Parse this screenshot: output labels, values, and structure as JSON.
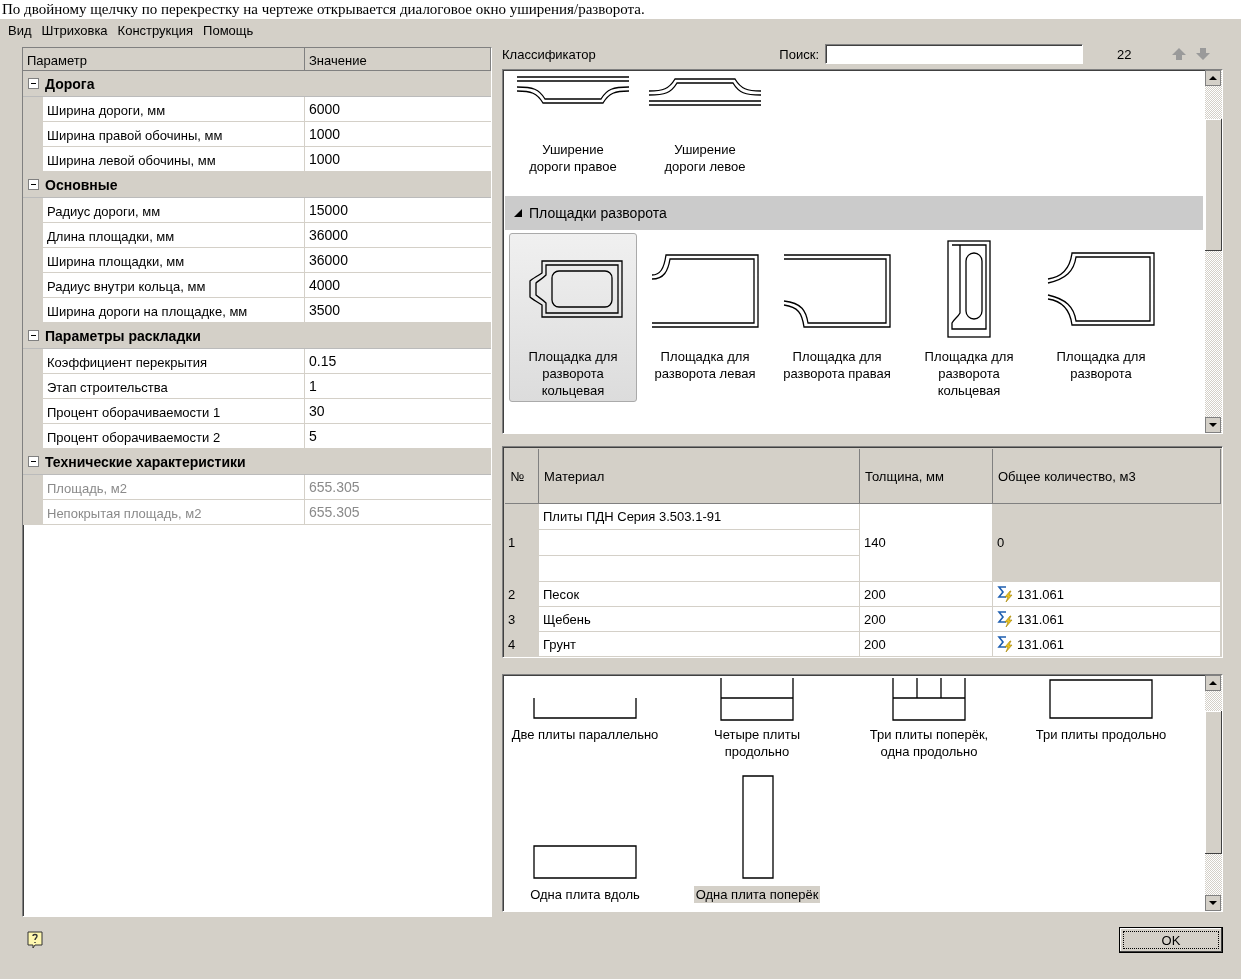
{
  "caption": "По двойному щелчку по перекрестку на чертеже открывается диалоговое окно уширения/разворота.",
  "menu": [
    "Вид",
    "Штриховка",
    "Конструкция",
    "Помощь"
  ],
  "properties": {
    "columns": [
      "Параметр",
      "Значение"
    ],
    "groups": [
      {
        "title": "Дорога",
        "expanded": true,
        "rows": [
          {
            "name": "Ширина дороги, мм",
            "value": "6000",
            "disabled": false
          },
          {
            "name": "Ширина правой обочины, мм",
            "value": "1000",
            "disabled": false
          },
          {
            "name": "Ширина левой обочины, мм",
            "value": "1000",
            "disabled": false
          }
        ]
      },
      {
        "title": "Основные",
        "expanded": true,
        "rows": [
          {
            "name": "Радиус дороги, мм",
            "value": "15000",
            "disabled": false
          },
          {
            "name": "Длина площадки, мм",
            "value": "36000",
            "disabled": false
          },
          {
            "name": "Ширина площадки, мм",
            "value": "36000",
            "disabled": false
          },
          {
            "name": "Радиус внутри кольца, мм",
            "value": "4000",
            "disabled": false
          },
          {
            "name": "Ширина дороги на площадке, мм",
            "value": "3500",
            "disabled": false
          }
        ]
      },
      {
        "title": "Параметры раскладки",
        "expanded": true,
        "rows": [
          {
            "name": "Коэффициент перекрытия",
            "value": "0.15",
            "disabled": false
          },
          {
            "name": "Этап строительства",
            "value": "1",
            "disabled": false
          },
          {
            "name": "Процент оборачиваемости 1",
            "value": "30",
            "disabled": false
          },
          {
            "name": "Процент оборачиваемости 2",
            "value": "5",
            "disabled": false
          }
        ]
      },
      {
        "title": "Технические характеристики",
        "expanded": true,
        "rows": [
          {
            "name": "Площадь, м2",
            "value": "655.305",
            "disabled": true
          },
          {
            "name": "Непокрытая площадь, м2",
            "value": "655.305",
            "disabled": true
          }
        ]
      }
    ]
  },
  "classifier": {
    "label": "Классификатор",
    "search_label": "Поиск:",
    "count": "22"
  },
  "gallery_top": {
    "sections": [
      {
        "items": [
          {
            "kind": "widening-right",
            "label": "Уширение дороги правое",
            "selected": false
          },
          {
            "kind": "widening-left",
            "label": "Уширение дороги левое",
            "selected": false
          }
        ]
      },
      {
        "title": "Площадки разворота",
        "expanded": true,
        "items": [
          {
            "kind": "ring",
            "label": "Площадка для разворота кольцевая",
            "selected": true
          },
          {
            "kind": "left",
            "label": "Площадка для разворота левая",
            "selected": false
          },
          {
            "kind": "right",
            "label": "Площадка для разворота правая",
            "selected": false
          },
          {
            "kind": "ring-left",
            "label": "Площадка для разворота кольцевая",
            "selected": false
          },
          {
            "kind": "plain",
            "label": "Площадка для разворота",
            "selected": false
          }
        ]
      }
    ]
  },
  "materials": {
    "columns": [
      "№",
      "Материал",
      "Толщина, мм",
      "Общее количество, м3"
    ],
    "rows": [
      {
        "kind": "slab",
        "number": "1",
        "material": "Плиты ПДН Серия 3.503.1-91",
        "thickness": "140",
        "total": "0",
        "computed": false
      },
      {
        "kind": "layer",
        "number": "2",
        "material": "Песок",
        "thickness": "200",
        "total": "131.061",
        "computed": true
      },
      {
        "kind": "layer",
        "number": "3",
        "material": "Щебень",
        "thickness": "200",
        "total": "131.061",
        "computed": true
      },
      {
        "kind": "layer",
        "number": "4",
        "material": "Грунт",
        "thickness": "200",
        "total": "131.061",
        "computed": true
      }
    ]
  },
  "gallery_bottom": {
    "sections": [
      {
        "items": [
          {
            "kind": "two-parallel",
            "label": "Две плиты параллельно",
            "selected": false
          },
          {
            "kind": "four-long",
            "label": "Четыре плиты продольно",
            "selected": false
          },
          {
            "kind": "three-cross",
            "label": "Три плиты поперёк, одна продольно",
            "selected": false
          },
          {
            "kind": "three-long",
            "label": "Три плиты продольно",
            "selected": false
          },
          {
            "kind": "one-along",
            "label": "Одна плита вдоль",
            "selected": false
          },
          {
            "kind": "one-across",
            "label": "Одна плита поперёк",
            "selected": true
          }
        ]
      }
    ]
  },
  "ok_button": "OK"
}
